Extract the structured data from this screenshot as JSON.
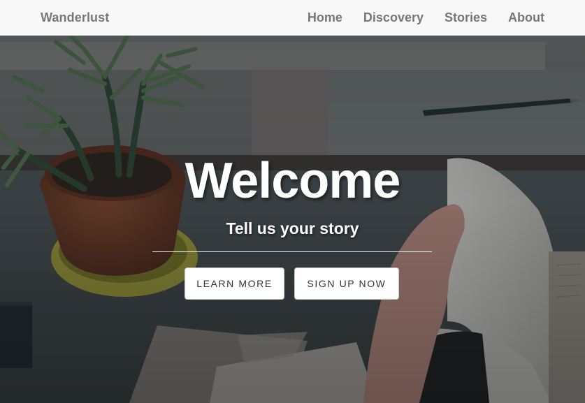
{
  "navbar": {
    "brand": "Wanderlust",
    "links": [
      {
        "label": "Home"
      },
      {
        "label": "Discovery"
      },
      {
        "label": "Stories"
      },
      {
        "label": "About"
      }
    ]
  },
  "hero": {
    "headline": "Welcome",
    "subtitle": "Tell us your story",
    "buttons": {
      "learn_more": "LEARN MORE",
      "sign_up": "SIGN UP NOW"
    },
    "background_image": "desk-with-potted-plant-and-open-book",
    "colors": {
      "overlay": "#3f4548",
      "text": "#ffffff",
      "nav_bg": "#f8f8f8",
      "nav_text": "#777777"
    }
  }
}
